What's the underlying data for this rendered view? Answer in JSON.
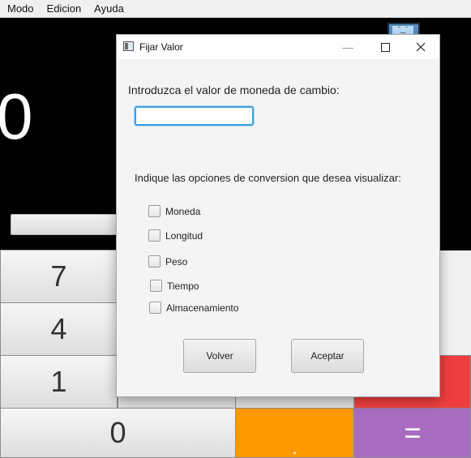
{
  "menu": [
    "Modo",
    "Edicion",
    "Ayuda"
  ],
  "display": {
    "value": "0"
  },
  "keypad": {
    "seven": "7",
    "four": "4",
    "one": "1",
    "zero": "0",
    "dot": ".",
    "equals": "=",
    "colors": {
      "orange": "#ff9900",
      "purple": "#a86cc0",
      "red": "#ef3e3e"
    }
  },
  "dialog": {
    "title": "Fijar Valor",
    "prompt": "Introduzca el valor de moneda de cambio:",
    "input": {
      "value": "",
      "placeholder": ""
    },
    "options_label": "Indique las opciones de conversion que desea visualizar:",
    "options": [
      "Moneda",
      "Longitud",
      "Peso",
      "Tiempo",
      "Almacenamiento"
    ],
    "buttons": {
      "back": "Volver",
      "accept": "Aceptar"
    },
    "window_controls": {
      "minimize": "minimize-icon",
      "maximize": "maximize-icon",
      "close": "close-icon"
    }
  }
}
